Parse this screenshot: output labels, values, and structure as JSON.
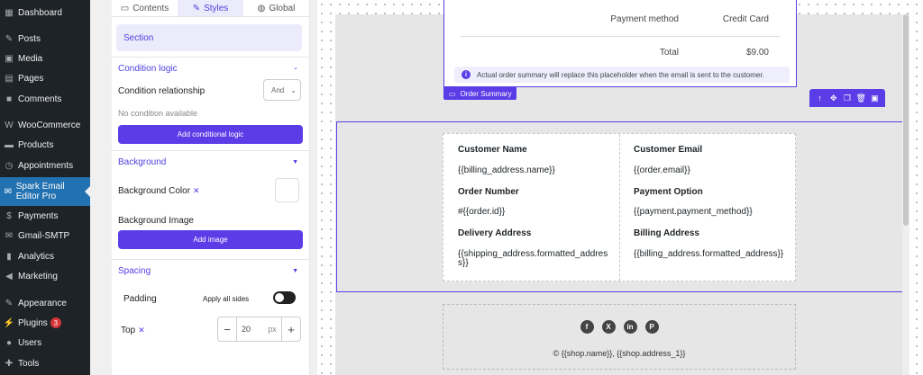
{
  "wp_menu": [
    {
      "label": "Dashboard",
      "icon": "dashboard-icon"
    },
    {
      "label": "Posts",
      "icon": "pin-icon"
    },
    {
      "label": "Media",
      "icon": "media-icon"
    },
    {
      "label": "Pages",
      "icon": "page-icon"
    },
    {
      "label": "Comments",
      "icon": "comment-icon"
    },
    {
      "label": "WooCommerce",
      "icon": "woo-icon"
    },
    {
      "label": "Products",
      "icon": "products-icon"
    },
    {
      "label": "Appointments",
      "icon": "clock-icon"
    },
    {
      "label": "Spark Email Editor Pro",
      "icon": "spark-icon",
      "active": true
    },
    {
      "label": "Payments",
      "icon": "payments-icon"
    },
    {
      "label": "Gmail-SMTP",
      "icon": "mail-icon"
    },
    {
      "label": "Analytics",
      "icon": "bar-chart-icon"
    },
    {
      "label": "Marketing",
      "icon": "megaphone-icon"
    },
    {
      "label": "Appearance",
      "icon": "brush-icon"
    },
    {
      "label": "Plugins",
      "icon": "plug-icon",
      "badge": "3"
    },
    {
      "label": "Users",
      "icon": "user-icon"
    },
    {
      "label": "Tools",
      "icon": "wrench-icon"
    }
  ],
  "panel": {
    "tabs": [
      {
        "label": "Contents",
        "icon": "content-icon"
      },
      {
        "label": "Styles",
        "icon": "pencil-icon",
        "active": true
      },
      {
        "label": "Global",
        "icon": "globe-icon"
      }
    ],
    "section_title": "Section",
    "condition": {
      "title": "Condition logic",
      "relationship_label": "Condition relationship",
      "relationship_value": "And",
      "empty_text": "No condition available",
      "add_button": "Add conditional logic"
    },
    "background": {
      "title": "Background",
      "color_label": "Background Color",
      "image_label": "Background Image",
      "add_image_button": "Add image"
    },
    "spacing": {
      "title": "Spacing",
      "padding_label": "Padding",
      "apply_all_label": "Apply all sides",
      "top_label": "Top",
      "top_value": "20",
      "unit": "px"
    }
  },
  "canvas": {
    "order_summary": {
      "rows": [
        {
          "key": "Payment method",
          "value": "Credit Card"
        },
        {
          "key": "Total",
          "value": "$9.00"
        }
      ],
      "notice": "Actual order summary will replace this placeholder when the email is sent to the customer.",
      "tag": "Order Summary"
    },
    "customer_info": {
      "left": [
        {
          "label": "Customer Name",
          "value": "{{billing_address.name}}"
        },
        {
          "label": "Order Number",
          "value": "#{{order.id}}"
        },
        {
          "label": "Delivery Address",
          "value": "{{shipping_address.formatted_address}}"
        }
      ],
      "right": [
        {
          "label": "Customer Email",
          "value": "{{order.email}}"
        },
        {
          "label": "Payment Option",
          "value": "{{payment.payment_method}}"
        },
        {
          "label": "Billing Address",
          "value": "{{billing_address.formatted_address}}"
        }
      ]
    },
    "footer": {
      "socials": [
        "f",
        "X",
        "in",
        "P"
      ],
      "text": "© {{shop.name}}, {{shop.address_1}}"
    }
  },
  "colors": {
    "accent": "#5b3de8",
    "wp_sidebar": "#1d2327",
    "wp_active": "#2271b1"
  }
}
